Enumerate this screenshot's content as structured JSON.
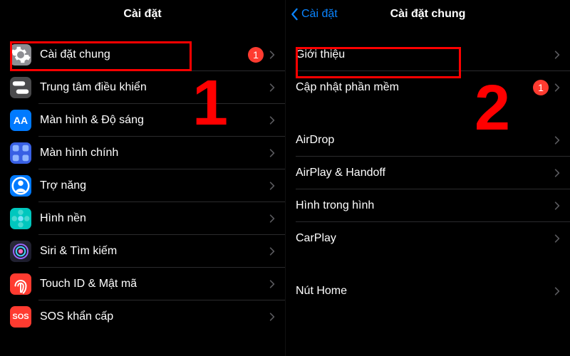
{
  "left": {
    "header_title": "Cài đặt",
    "rows": [
      {
        "id": "general",
        "label": "Cài đặt chung",
        "icon": "gear",
        "icon_bg": "bg-gray",
        "badge": "1"
      },
      {
        "id": "control",
        "label": "Trung tâm điều khiển",
        "icon": "switches",
        "icon_bg": "bg-gray2"
      },
      {
        "id": "display",
        "label": "Màn hình & Độ sáng",
        "icon": "AA",
        "icon_bg": "bg-blue"
      },
      {
        "id": "home",
        "label": "Màn hình chính",
        "icon": "grid",
        "icon_bg": "bg-indigo"
      },
      {
        "id": "access",
        "label": "Trợ năng",
        "icon": "person",
        "icon_bg": "bg-blue"
      },
      {
        "id": "wallpaper",
        "label": "Hình nền",
        "icon": "flower",
        "icon_bg": "bg-teal"
      },
      {
        "id": "siri",
        "label": "Siri & Tìm kiếm",
        "icon": "siri",
        "icon_bg": "bg-siri"
      },
      {
        "id": "touchid",
        "label": "Touch ID & Mật mã",
        "icon": "finger",
        "icon_bg": "bg-red"
      },
      {
        "id": "sos",
        "label": "SOS khẩn cấp",
        "icon": "sos",
        "icon_bg": "bg-sos"
      }
    ]
  },
  "right": {
    "back_label": "Cài đặt",
    "header_title": "Cài đặt chung",
    "groups": [
      [
        {
          "id": "about",
          "label": "Giới thiệu"
        },
        {
          "id": "update",
          "label": "Cập nhật phần mềm",
          "badge": "1"
        }
      ],
      [
        {
          "id": "airdrop",
          "label": "AirDrop"
        },
        {
          "id": "airplay",
          "label": "AirPlay & Handoff"
        },
        {
          "id": "pip",
          "label": "Hình trong hình"
        },
        {
          "id": "carplay",
          "label": "CarPlay"
        }
      ],
      [
        {
          "id": "homebtn",
          "label": "Nút Home"
        }
      ]
    ]
  },
  "annotations": {
    "step1": "1",
    "step2": "2"
  }
}
